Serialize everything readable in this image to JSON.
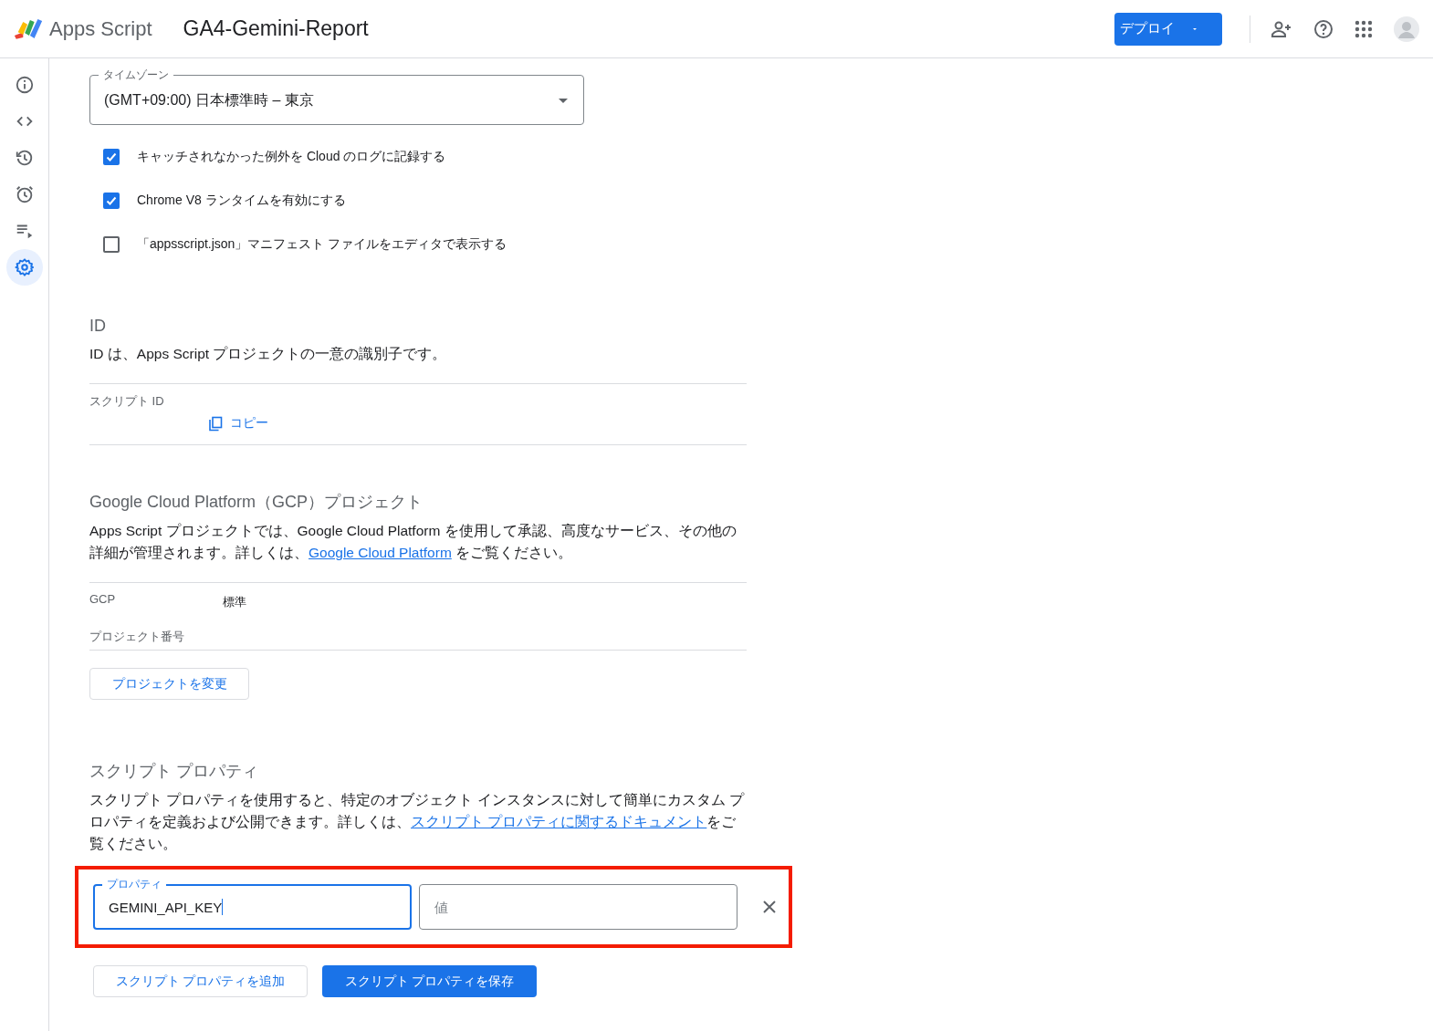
{
  "header": {
    "product": "Apps Script",
    "project_title": "GA4-Gemini-Report",
    "deploy_button": "デプロイ"
  },
  "sidebar": {
    "items": [
      {
        "kind": "info",
        "selected": false
      },
      {
        "kind": "code",
        "selected": false
      },
      {
        "kind": "history",
        "selected": false
      },
      {
        "kind": "alarm",
        "selected": false
      },
      {
        "kind": "executions",
        "selected": false
      },
      {
        "kind": "settings",
        "selected": true
      }
    ]
  },
  "timezone": {
    "label": "タイムゾーン",
    "value": "(GMT+09:00) 日本標準時 – 東京"
  },
  "options": [
    {
      "label": "キャッチされなかった例外を Cloud のログに記録する",
      "checked": true
    },
    {
      "label": "Chrome V8 ランタイムを有効にする",
      "checked": true
    },
    {
      "label": "「appsscript.json」マニフェスト ファイルをエディタで表示する",
      "checked": false
    }
  ],
  "id_section": {
    "heading": "ID",
    "description": "ID は、Apps Script プロジェクトの一意の識別子です。",
    "script_id_label": "スクリプト ID",
    "copy_link": "コピー"
  },
  "gcp_section": {
    "heading": "Google Cloud Platform（GCP）プロジェクト",
    "description": {
      "before": "Apps Script プロジェクトでは、Google Cloud Platform を使用して承認、高度なサービス、その他の詳細が管理されます。詳しくは、",
      "link": "Google Cloud Platform",
      "after": " をご覧ください。"
    },
    "gcp_label": "GCP",
    "gcp_value": "標準",
    "project_number_label": "プロジェクト番号",
    "change_button": "プロジェクトを変更"
  },
  "properties_section": {
    "heading": "スクリプト プロパティ",
    "description": {
      "before": "スクリプト プロパティを使用すると、特定のオブジェクト インスタンスに対して簡単にカスタム プロパティを定義および公開できます。詳しくは、",
      "link": "スクリプト プロパティに関するドキュメント",
      "after": "をご覧ください。"
    },
    "rows": [
      {
        "property_label": "プロパティ",
        "property_value": "GEMINI_API_KEY",
        "focused": true,
        "value_placeholder": "値"
      }
    ],
    "add_button": "スクリプト プロパティを追加",
    "save_button": "スクリプト プロパティを保存"
  }
}
